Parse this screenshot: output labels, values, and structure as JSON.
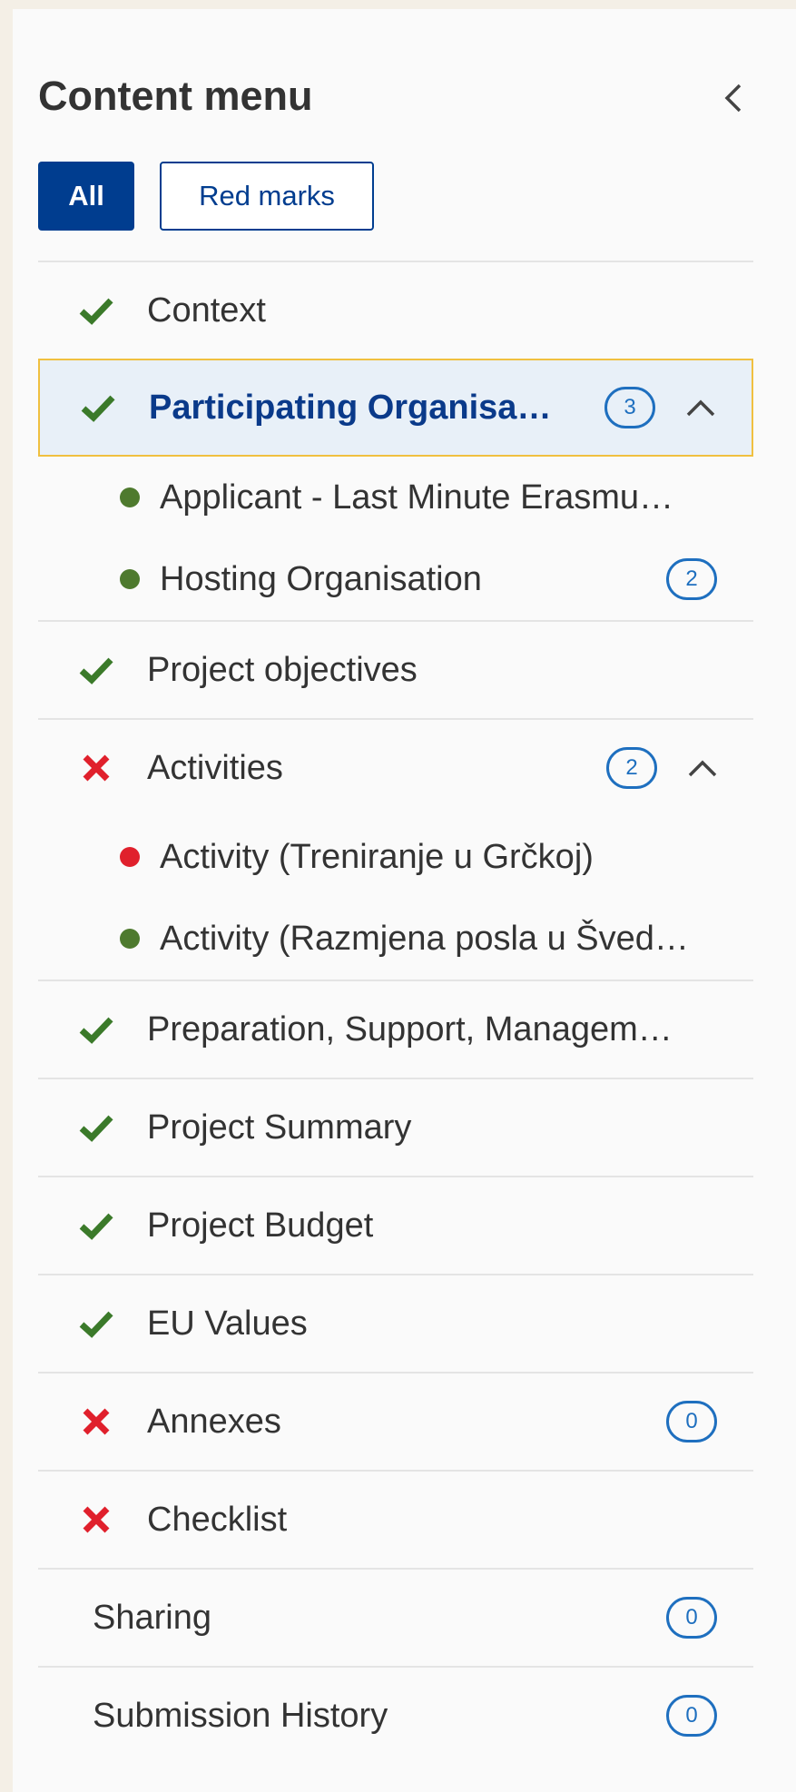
{
  "header": {
    "title": "Content menu"
  },
  "filters": {
    "all": "All",
    "red_marks": "Red marks"
  },
  "colors": {
    "check": "#3b7a2a",
    "cross": "#e0202c",
    "dot_ok": "#4e7a2e",
    "dot_err": "#e0202c",
    "accent": "#003d8f"
  },
  "menu": [
    {
      "label": "Context",
      "status": "ok"
    },
    {
      "label": "Participating Organisa…",
      "status": "ok",
      "badge": "3",
      "expanded": true,
      "children": [
        {
          "label": "Applicant - Last Minute Erasmu…",
          "status": "ok"
        },
        {
          "label": "Hosting Organisation",
          "status": "ok",
          "badge": "2"
        }
      ]
    },
    {
      "label": "Project objectives",
      "status": "ok"
    },
    {
      "label": "Activities",
      "status": "error",
      "badge": "2",
      "expanded": true,
      "children": [
        {
          "label": "Activity (Treniranje u Grčkoj)",
          "status": "error"
        },
        {
          "label": "Activity (Razmjena posla u Šved…",
          "status": "ok"
        }
      ]
    },
    {
      "label": "Preparation, Support, Managem…",
      "status": "ok"
    },
    {
      "label": "Project Summary",
      "status": "ok"
    },
    {
      "label": "Project Budget",
      "status": "ok"
    },
    {
      "label": "EU Values",
      "status": "ok"
    },
    {
      "label": "Annexes",
      "status": "error",
      "badge": "0"
    },
    {
      "label": "Checklist",
      "status": "error"
    },
    {
      "label": "Sharing",
      "badge": "0"
    },
    {
      "label": "Submission History",
      "badge": "0"
    }
  ]
}
